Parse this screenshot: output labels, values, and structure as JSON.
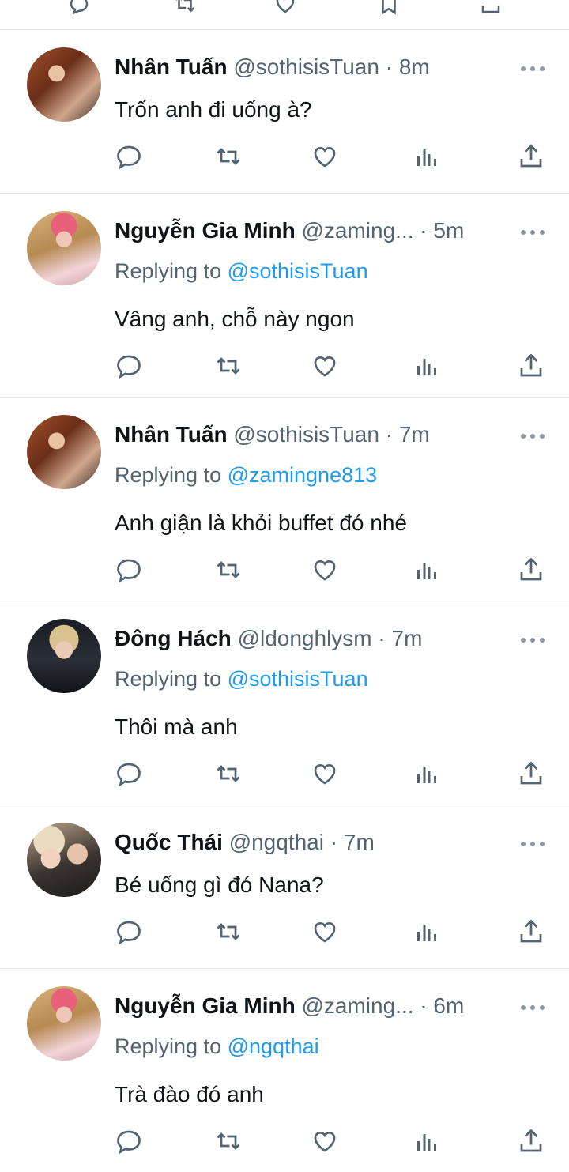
{
  "colors": {
    "accent": "#1d9bf0",
    "text": "#0f1419",
    "secondary": "#536471",
    "divider": "#e1e6ea"
  },
  "icons": {
    "reply": "comment-icon",
    "retweet": "retweet-icon",
    "like": "heart-icon",
    "analytics": "analytics-icon",
    "share": "share-icon",
    "more": "more-icon"
  },
  "tweets": [
    {
      "name": "Nhân Tuấn",
      "handle": "@sothisisTuan",
      "sep": "·",
      "time": "8m",
      "reply_prefix": "",
      "reply_to": "",
      "text": "Trốn anh đi uống à?"
    },
    {
      "name": "Nguyễn Gia Minh",
      "handle": "@zaming...",
      "sep": "·",
      "time": "5m",
      "reply_prefix": "Replying to",
      "reply_to": "@sothisisTuan",
      "text": "Vâng anh, chỗ này ngon"
    },
    {
      "name": "Nhân Tuấn",
      "handle": "@sothisisTuan",
      "sep": "·",
      "time": "7m",
      "reply_prefix": "Replying to",
      "reply_to": "@zamingne813",
      "text": "Anh giận là khỏi buffet đó nhé"
    },
    {
      "name": "Đông Hách",
      "handle": "@ldonghlysm",
      "sep": "·",
      "time": "7m",
      "reply_prefix": "Replying to",
      "reply_to": "@sothisisTuan",
      "text": "Thôi mà anh"
    },
    {
      "name": "Quốc Thái",
      "handle": "@ngqthai",
      "sep": "·",
      "time": "7m",
      "reply_prefix": "",
      "reply_to": "",
      "text": "Bé uống gì đó Nana?"
    },
    {
      "name": "Nguyễn Gia Minh",
      "handle": "@zaming...",
      "sep": "·",
      "time": "6m",
      "reply_prefix": "Replying to",
      "reply_to": "@ngqthai",
      "text": "Trà đào đó anh"
    }
  ]
}
